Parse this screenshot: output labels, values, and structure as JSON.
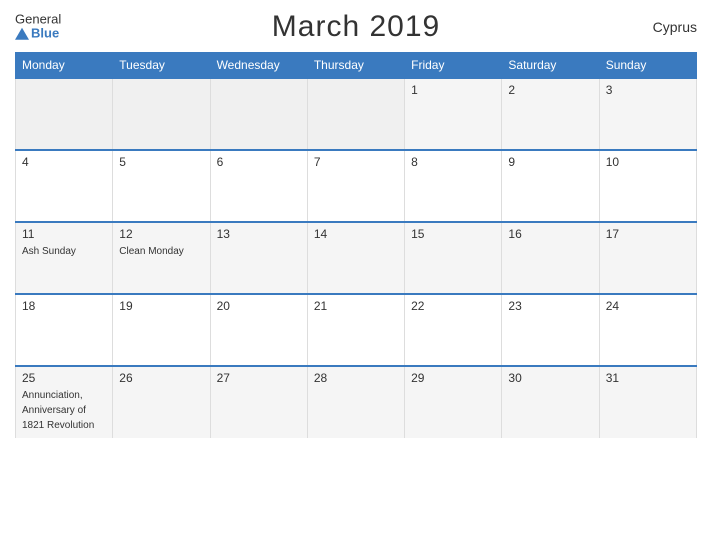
{
  "header": {
    "logo_general": "General",
    "logo_blue": "Blue",
    "title": "March 2019",
    "country": "Cyprus"
  },
  "calendar": {
    "weekdays": [
      "Monday",
      "Tuesday",
      "Wednesday",
      "Thursday",
      "Friday",
      "Saturday",
      "Sunday"
    ],
    "weeks": [
      [
        {
          "day": "",
          "empty": true
        },
        {
          "day": "",
          "empty": true
        },
        {
          "day": "",
          "empty": true
        },
        {
          "day": "",
          "empty": true
        },
        {
          "day": "1",
          "empty": false,
          "event": ""
        },
        {
          "day": "2",
          "empty": false,
          "event": ""
        },
        {
          "day": "3",
          "empty": false,
          "event": ""
        }
      ],
      [
        {
          "day": "4",
          "empty": false,
          "event": ""
        },
        {
          "day": "5",
          "empty": false,
          "event": ""
        },
        {
          "day": "6",
          "empty": false,
          "event": ""
        },
        {
          "day": "7",
          "empty": false,
          "event": ""
        },
        {
          "day": "8",
          "empty": false,
          "event": ""
        },
        {
          "day": "9",
          "empty": false,
          "event": ""
        },
        {
          "day": "10",
          "empty": false,
          "event": ""
        }
      ],
      [
        {
          "day": "11",
          "empty": false,
          "event": "Ash Sunday"
        },
        {
          "day": "12",
          "empty": false,
          "event": "Clean Monday"
        },
        {
          "day": "13",
          "empty": false,
          "event": ""
        },
        {
          "day": "14",
          "empty": false,
          "event": ""
        },
        {
          "day": "15",
          "empty": false,
          "event": ""
        },
        {
          "day": "16",
          "empty": false,
          "event": ""
        },
        {
          "day": "17",
          "empty": false,
          "event": ""
        }
      ],
      [
        {
          "day": "18",
          "empty": false,
          "event": ""
        },
        {
          "day": "19",
          "empty": false,
          "event": ""
        },
        {
          "day": "20",
          "empty": false,
          "event": ""
        },
        {
          "day": "21",
          "empty": false,
          "event": ""
        },
        {
          "day": "22",
          "empty": false,
          "event": ""
        },
        {
          "day": "23",
          "empty": false,
          "event": ""
        },
        {
          "day": "24",
          "empty": false,
          "event": ""
        }
      ],
      [
        {
          "day": "25",
          "empty": false,
          "event": "Annunciation, Anniversary of 1821 Revolution"
        },
        {
          "day": "26",
          "empty": false,
          "event": ""
        },
        {
          "day": "27",
          "empty": false,
          "event": ""
        },
        {
          "day": "28",
          "empty": false,
          "event": ""
        },
        {
          "day": "29",
          "empty": false,
          "event": ""
        },
        {
          "day": "30",
          "empty": false,
          "event": ""
        },
        {
          "day": "31",
          "empty": false,
          "event": ""
        }
      ]
    ]
  }
}
